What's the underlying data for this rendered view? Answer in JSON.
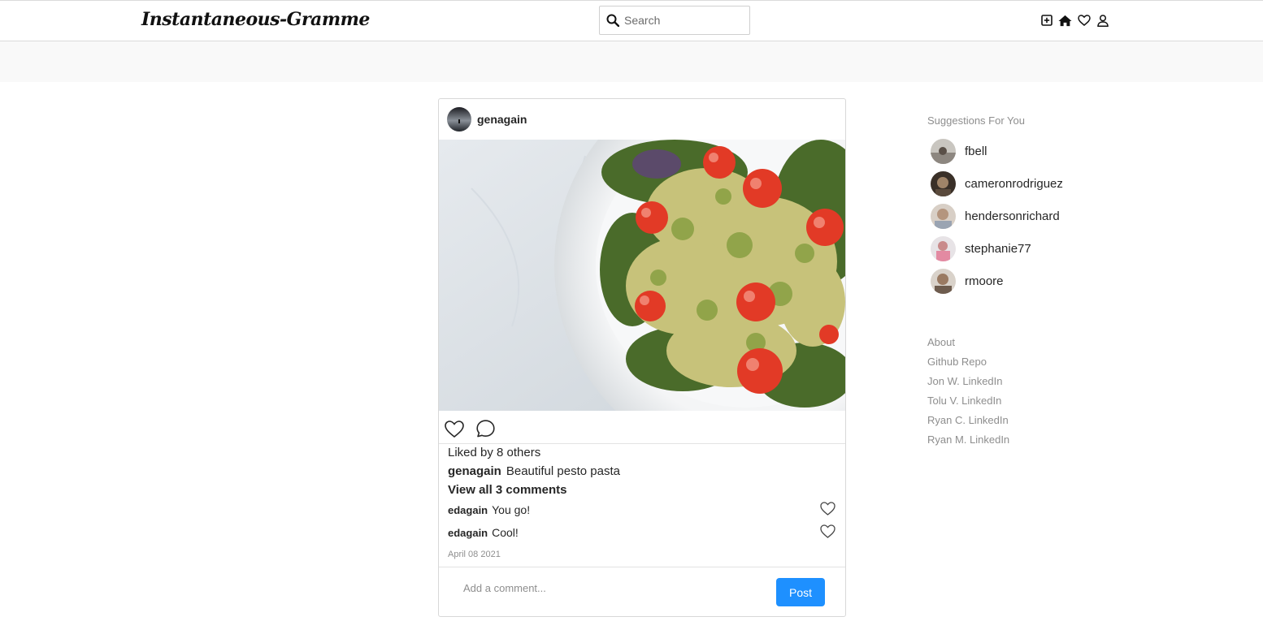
{
  "header": {
    "logo": "Instantaneous-Gramme",
    "search_placeholder": "Search",
    "icons": [
      "new-post-icon",
      "home-icon",
      "heart-icon",
      "profile-icon"
    ]
  },
  "post": {
    "username": "genagain",
    "likes_text": "Liked by 8 others",
    "caption_user": "genagain",
    "caption_text": "Beautiful pesto pasta",
    "view_all": "View all 3 comments",
    "comments": [
      {
        "user": "edagain",
        "text": "You go!"
      },
      {
        "user": "edagain",
        "text": "Cool!"
      }
    ],
    "date": "April 08 2021",
    "comment_placeholder": "Add a comment...",
    "post_button": "Post"
  },
  "sidebar": {
    "title": "Suggestions For You",
    "suggestions": [
      {
        "name": "fbell"
      },
      {
        "name": "cameronrodriguez"
      },
      {
        "name": "hendersonrichard"
      },
      {
        "name": "stephanie77"
      },
      {
        "name": "rmoore"
      }
    ],
    "links": [
      "About",
      "Github Repo",
      "Jon W. LinkedIn",
      "Tolu V. LinkedIn",
      "Ryan C. LinkedIn",
      "Ryan M. LinkedIn"
    ]
  },
  "colors": {
    "accent": "#1e90ff",
    "muted": "#8e8e8e",
    "text": "#262626",
    "band": "#f9f9f9"
  }
}
